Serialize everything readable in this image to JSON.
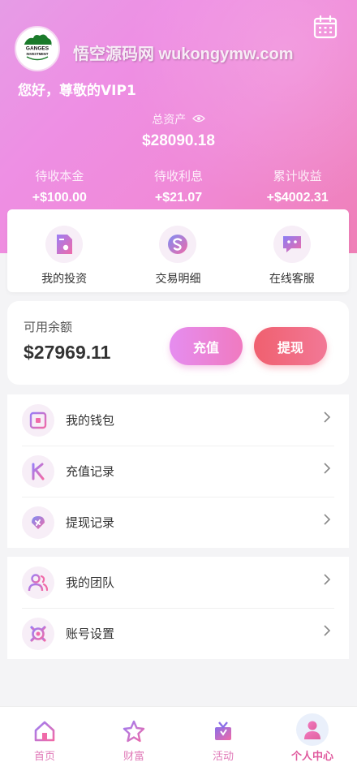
{
  "header": {
    "watermark": "悟空源码网 wukongymw.com",
    "greeting": "您好，尊敬的VIP1",
    "total_label": "总资产",
    "total_value": "$28090.18",
    "stats": [
      {
        "label": "待收本金",
        "value": "+$100.00"
      },
      {
        "label": "待收利息",
        "value": "+$21.07"
      },
      {
        "label": "累计收益",
        "value": "+$4002.31"
      }
    ],
    "avatar_logo_text": "GANGES INVESTMENT"
  },
  "quick_actions": [
    {
      "label": "我的投资",
      "icon": "investment-icon"
    },
    {
      "label": "交易明细",
      "icon": "transaction-icon"
    },
    {
      "label": "在线客服",
      "icon": "chat-icon"
    }
  ],
  "balance": {
    "label": "可用余额",
    "value": "$27969.11",
    "recharge_label": "充值",
    "withdraw_label": "提现"
  },
  "menu_group_1": [
    {
      "label": "我的钱包",
      "icon": "wallet-icon"
    },
    {
      "label": "充值记录",
      "icon": "recharge-record-icon"
    },
    {
      "label": "提现记录",
      "icon": "withdraw-record-icon"
    }
  ],
  "menu_group_2": [
    {
      "label": "我的团队",
      "icon": "team-icon"
    },
    {
      "label": "账号设置",
      "icon": "settings-icon"
    }
  ],
  "tabbar": [
    {
      "label": "首页",
      "icon": "home-icon"
    },
    {
      "label": "财富",
      "icon": "star-icon"
    },
    {
      "label": "活动",
      "icon": "gift-icon"
    },
    {
      "label": "个人中心",
      "icon": "user-icon",
      "active": true
    }
  ],
  "colors": {
    "accent_pink": "#e07ab8",
    "gradient_start": "#e69ce6",
    "gradient_end": "#ef7fb6",
    "withdraw_red": "#f0606f"
  }
}
